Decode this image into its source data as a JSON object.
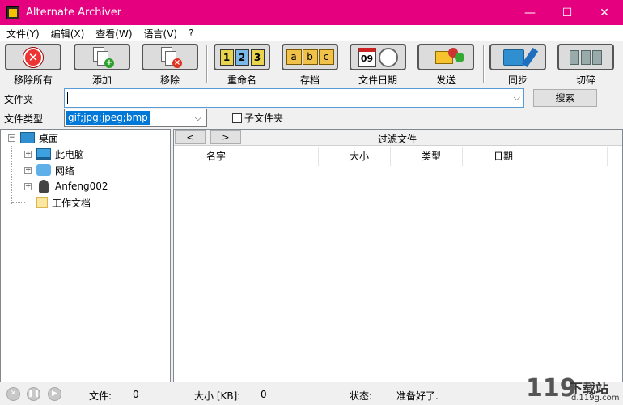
{
  "window": {
    "title": "Alternate Archiver",
    "minimize": "—",
    "maximize": "☐",
    "close": "✕"
  },
  "menu": [
    "文件(Y)",
    "编辑(X)",
    "查看(W)",
    "语言(V)",
    "?"
  ],
  "toolbar": {
    "remove_all": "移除所有",
    "add": "添加",
    "remove": "移除",
    "rename": "重命名",
    "archive": "存档",
    "file_date": "文件日期",
    "send": "发送",
    "sync": "同步",
    "shred": "切碎",
    "rename_digits": [
      "1",
      "2",
      "3"
    ],
    "archive_letters": [
      "a",
      "b",
      "c"
    ],
    "calendar_day": "09"
  },
  "options": {
    "folder_label": "文件夹",
    "folder_value": "",
    "search_button": "搜索",
    "filetype_label": "文件类型",
    "filetype_value": "gif;jpg;jpeg;bmp",
    "subfolder_label": "子文件夹",
    "subfolder_checked": false
  },
  "tree": {
    "root": "桌面",
    "items": [
      "此电脑",
      "网络",
      "Anfeng002",
      "工作文档"
    ]
  },
  "files": {
    "prev": "<",
    "next": ">",
    "filter_label": "过滤文件",
    "columns": [
      "名字",
      "大小",
      "类型",
      "日期"
    ]
  },
  "status": {
    "files_label": "文件:",
    "files_count": "0",
    "size_label": "大小 [KB]:",
    "size_value": "0",
    "state_label": "状态:",
    "state_value": "准备好了."
  },
  "watermark": {
    "mark": "119",
    "site": "下载站",
    "url": "d.119g.com"
  },
  "colors": {
    "titlebar": "#e4007f",
    "selection": "#0078d7"
  }
}
